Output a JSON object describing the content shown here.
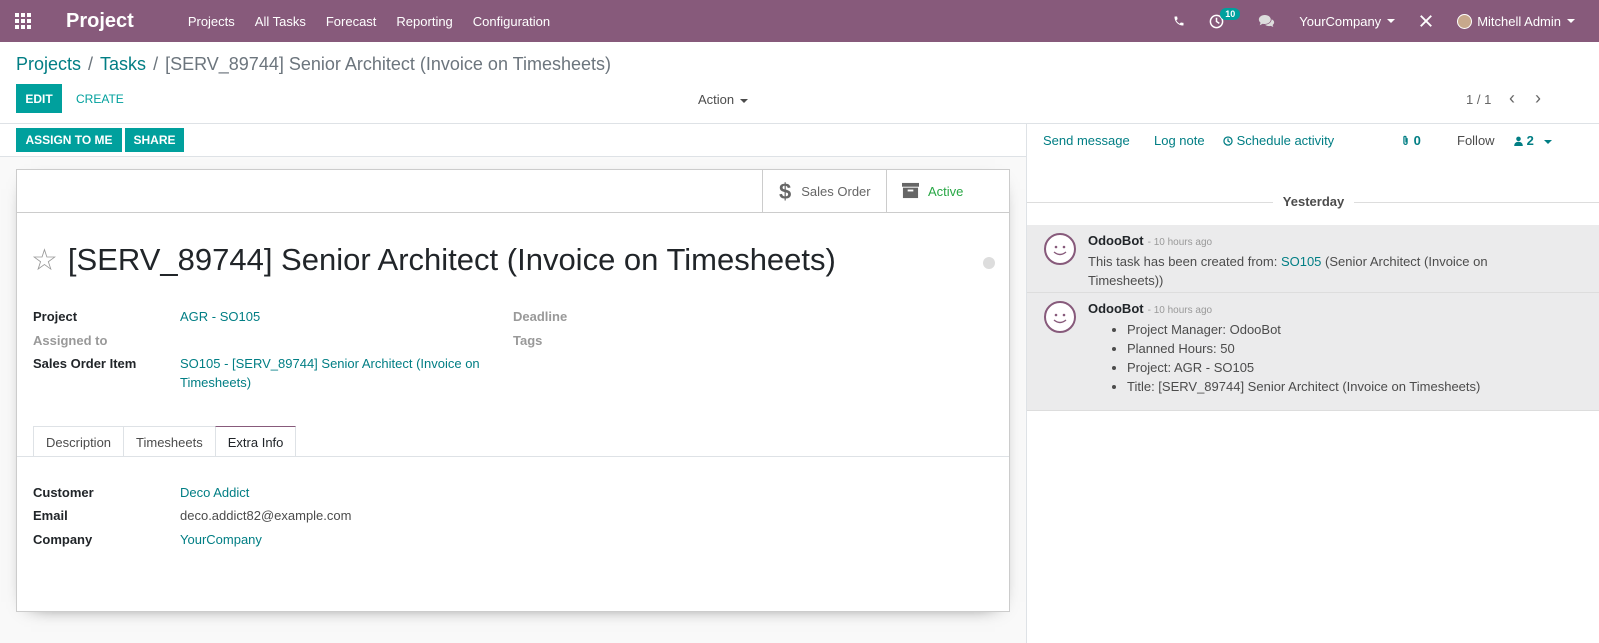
{
  "navbar": {
    "app_name": "Project",
    "menu": [
      "Projects",
      "All Tasks",
      "Forecast",
      "Reporting",
      "Configuration"
    ],
    "activity_count": "10",
    "company": "YourCompany",
    "user": "Mitchell Admin"
  },
  "breadcrumb": {
    "items": [
      "Projects",
      "Tasks"
    ],
    "current": "[SERV_89744] Senior Architect (Invoice on Timesheets)"
  },
  "toolbar": {
    "edit": "EDIT",
    "create": "CREATE",
    "action": "Action",
    "pager": "1 / 1"
  },
  "statusbar": {
    "assign": "ASSIGN TO ME",
    "share": "SHARE"
  },
  "smart_buttons": {
    "sales_order": "Sales Order",
    "active": "Active"
  },
  "task": {
    "title": "[SERV_89744] Senior Architect (Invoice on Timesheets)",
    "fields": {
      "project_label": "Project",
      "project_value": "AGR - SO105",
      "assigned_label": "Assigned to",
      "sol_label": "Sales Order Item",
      "sol_value_1": "SO105 - [SERV_89744] Senior Architect (Invoice on",
      "sol_value_2": "Timesheets)",
      "deadline_label": "Deadline",
      "tags_label": "Tags"
    },
    "tabs": [
      "Description",
      "Timesheets",
      "Extra Info"
    ],
    "extra": {
      "customer_label": "Customer",
      "customer_value": "Deco Addict",
      "email_label": "Email",
      "email_value": "deco.addict82@example.com",
      "company_label": "Company",
      "company_value": "YourCompany"
    }
  },
  "chatter": {
    "send_message": "Send message",
    "log_note": "Log note",
    "schedule_activity": "Schedule activity",
    "attachments": "0",
    "follow": "Follow",
    "followers": "2",
    "day": "Yesterday",
    "messages": [
      {
        "author": "OdooBot",
        "time": "- 10 hours ago",
        "text_pre": "This task has been created from: ",
        "link": "SO105",
        "text_post_1": " (Senior Architect (Invoice on",
        "text_post_2": "Timesheets))"
      },
      {
        "author": "OdooBot",
        "time": "- 10 hours ago",
        "changes": [
          "Project Manager: OdooBot",
          "Planned Hours: 50",
          "Project: AGR - SO105",
          "Title: [SERV_89744] Senior Architect (Invoice on Timesheets)"
        ]
      }
    ]
  },
  "colors": {
    "brand": "#875a7b",
    "primary": "#00a09d",
    "link": "#017e84",
    "active_green": "#28a745"
  }
}
